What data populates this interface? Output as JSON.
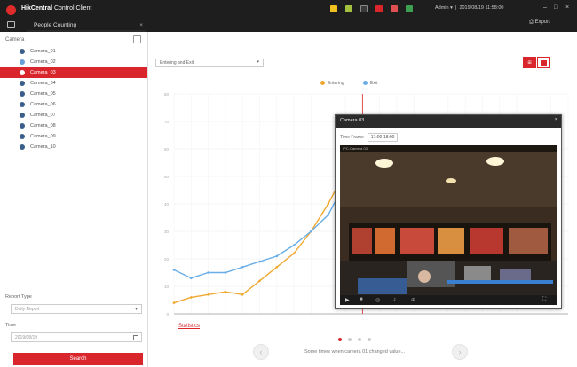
{
  "app": {
    "name_bold": "HikCentral",
    "name_rest": "Control Client",
    "tab_label": "People Counting"
  },
  "header": {
    "user": "Admin ▾",
    "time": "2019/08/19 11:58:00",
    "export_label": "Export"
  },
  "sidebar": {
    "title": "Camera",
    "cameras": [
      {
        "label": "Camera_01",
        "state": "normal"
      },
      {
        "label": "Camera_02",
        "state": "checked"
      },
      {
        "label": "Camera_03",
        "state": "active"
      },
      {
        "label": "Camera_04",
        "state": "normal"
      },
      {
        "label": "Camera_05",
        "state": "normal"
      },
      {
        "label": "Camera_06",
        "state": "normal"
      },
      {
        "label": "Camera_07",
        "state": "normal"
      },
      {
        "label": "Camera_08",
        "state": "normal"
      },
      {
        "label": "Camera_09",
        "state": "normal"
      },
      {
        "label": "Camera_10",
        "state": "normal"
      }
    ],
    "report_type_label": "Report Type",
    "report_type_value": "Daily Report",
    "time_label": "Time",
    "time_value": "2019/08/19",
    "search_button": "Search"
  },
  "main": {
    "dropdown_value": "Entering and Exit",
    "legend": {
      "enter": "Entering",
      "exit": "Exit"
    },
    "link_text": "Statistics",
    "caption": "Some times when camera 01 changed value...",
    "prev_icon": "chevron-left-icon",
    "next_icon": "chevron-right-icon"
  },
  "popup": {
    "title": "Camera 03",
    "time_label": "Time Frame",
    "time_value": "17:00-18:00",
    "video_label": "IPC-Camera 03"
  },
  "colors": {
    "accent": "#d9262c",
    "entering": "#f0a830",
    "exit": "#6aaee8",
    "titlebar": "#1e1e1e"
  },
  "chart_data": {
    "type": "line",
    "x": [
      0,
      1,
      2,
      3,
      4,
      5,
      6,
      7,
      8,
      9,
      10,
      11,
      12,
      13,
      14,
      15,
      16,
      17,
      18,
      19,
      20,
      21,
      22,
      23
    ],
    "series": [
      {
        "name": "Entering",
        "values": [
          4,
          6,
          7,
          8,
          7,
          12,
          17,
          22,
          30,
          40,
          52,
          54,
          null,
          null,
          null,
          null,
          null,
          null,
          null,
          null,
          null,
          null,
          null,
          null
        ]
      },
      {
        "name": "Exit",
        "values": [
          16,
          13,
          15,
          15,
          17,
          19,
          21,
          25,
          30,
          36,
          48,
          50,
          null,
          null,
          null,
          null,
          null,
          null,
          null,
          null,
          null,
          null,
          null,
          null
        ]
      }
    ],
    "ylim": [
      0,
      80
    ],
    "marker_x": 11
  }
}
